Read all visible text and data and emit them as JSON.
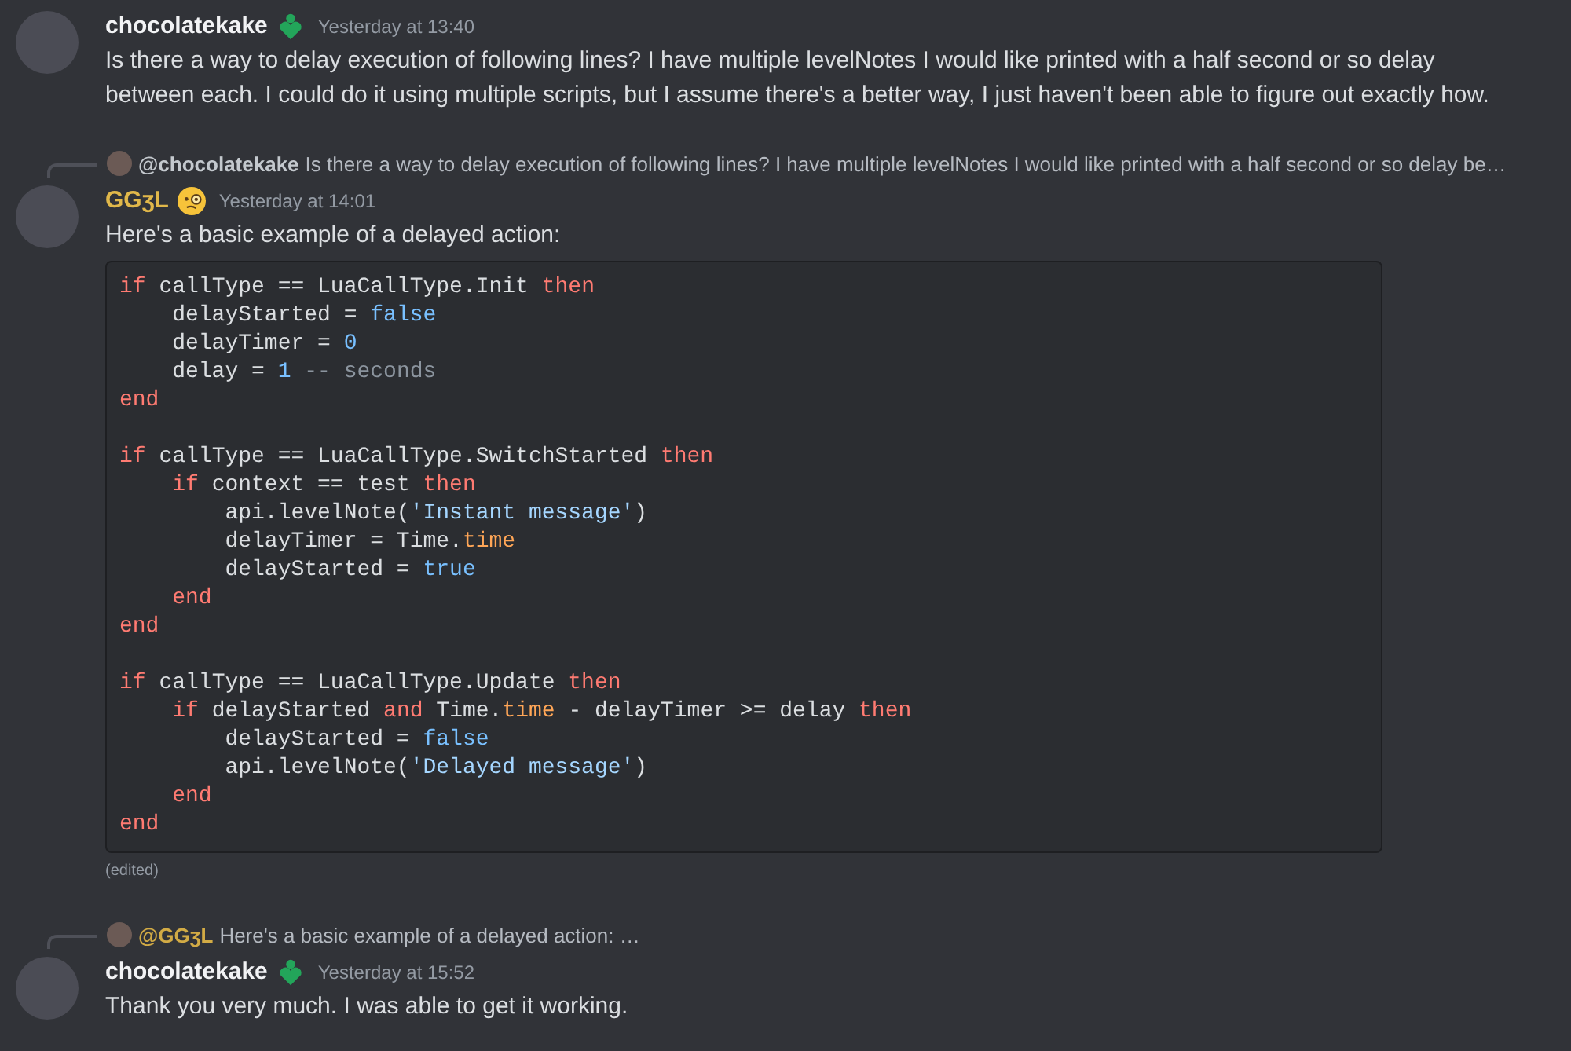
{
  "messages": [
    {
      "author": {
        "name": "chocolatekake",
        "color": "#f2f3f5",
        "badge": {
          "kind": "heart"
        }
      },
      "timestamp": "Yesterday at 13:40",
      "text": "Is there a way to delay execution of following lines? I have multiple levelNotes I would like printed with a half second or so delay between each. I could do it using multiple scripts, but I assume there's a better way, I just haven't been able to figure out exactly how."
    },
    {
      "reply": {
        "mention": "@chocolatekake",
        "color": "#c4c9ce",
        "text": "Is there a way to delay execution of following lines? I have multiple levelNotes I would like printed with a half second or so delay be…"
      },
      "author": {
        "name": "GGʒL",
        "color": "#e1b84a",
        "badge": {
          "kind": "emoji"
        }
      },
      "timestamp": "Yesterday at 14:01",
      "text": "Here's a basic example of a delayed action:",
      "code": {
        "lines": [
          {
            "kind": "code",
            "tokens": [
              {
                "kind": "keyword",
                "text": "if"
              },
              {
                "kind": "plain",
                "text": " callType == LuaCallType.Init "
              },
              {
                "kind": "keyword",
                "text": "then"
              }
            ]
          },
          {
            "kind": "code",
            "tokens": [
              {
                "kind": "plain",
                "text": "    delayStarted = "
              },
              {
                "kind": "literal",
                "text": "false"
              }
            ]
          },
          {
            "kind": "code",
            "tokens": [
              {
                "kind": "plain",
                "text": "    delayTimer = "
              },
              {
                "kind": "literal",
                "text": "0"
              }
            ]
          },
          {
            "kind": "code",
            "tokens": [
              {
                "kind": "plain",
                "text": "    delay = "
              },
              {
                "kind": "literal",
                "text": "1"
              },
              {
                "kind": "comment",
                "text": " -- seconds"
              }
            ]
          },
          {
            "kind": "code",
            "tokens": [
              {
                "kind": "keyword",
                "text": "end"
              }
            ]
          },
          {
            "kind": "blank"
          },
          {
            "kind": "code",
            "tokens": [
              {
                "kind": "keyword",
                "text": "if"
              },
              {
                "kind": "plain",
                "text": " callType == LuaCallType.SwitchStarted "
              },
              {
                "kind": "keyword",
                "text": "then"
              }
            ]
          },
          {
            "kind": "code",
            "tokens": [
              {
                "kind": "keyword",
                "text": "    if"
              },
              {
                "kind": "plain",
                "text": " context == test "
              },
              {
                "kind": "keyword",
                "text": "then"
              }
            ]
          },
          {
            "kind": "code",
            "tokens": [
              {
                "kind": "plain",
                "text": "        api.levelNote("
              },
              {
                "kind": "string",
                "text": "'Instant message'"
              },
              {
                "kind": "plain",
                "text": ")"
              }
            ]
          },
          {
            "kind": "code",
            "tokens": [
              {
                "kind": "plain",
                "text": "        delayTimer = Time."
              },
              {
                "kind": "property",
                "text": "time"
              }
            ]
          },
          {
            "kind": "code",
            "tokens": [
              {
                "kind": "plain",
                "text": "        delayStarted = "
              },
              {
                "kind": "literal",
                "text": "true"
              }
            ]
          },
          {
            "kind": "code",
            "tokens": [
              {
                "kind": "keyword",
                "text": "    end"
              }
            ]
          },
          {
            "kind": "code",
            "tokens": [
              {
                "kind": "keyword",
                "text": "end"
              }
            ]
          },
          {
            "kind": "blank"
          },
          {
            "kind": "code",
            "tokens": [
              {
                "kind": "keyword",
                "text": "if"
              },
              {
                "kind": "plain",
                "text": " callType == LuaCallType.Update "
              },
              {
                "kind": "keyword",
                "text": "then"
              }
            ]
          },
          {
            "kind": "code",
            "tokens": [
              {
                "kind": "keyword",
                "text": "    if"
              },
              {
                "kind": "plain",
                "text": " delayStarted "
              },
              {
                "kind": "keyword",
                "text": "and"
              },
              {
                "kind": "plain",
                "text": " Time."
              },
              {
                "kind": "property",
                "text": "time"
              },
              {
                "kind": "plain",
                "text": " - delayTimer >= delay "
              },
              {
                "kind": "keyword",
                "text": "then"
              }
            ]
          },
          {
            "kind": "code",
            "tokens": [
              {
                "kind": "plain",
                "text": "        delayStarted = "
              },
              {
                "kind": "literal",
                "text": "false"
              }
            ]
          },
          {
            "kind": "code",
            "tokens": [
              {
                "kind": "plain",
                "text": "        api.levelNote("
              },
              {
                "kind": "string",
                "text": "'Delayed message'"
              },
              {
                "kind": "plain",
                "text": ")"
              }
            ]
          },
          {
            "kind": "code",
            "tokens": [
              {
                "kind": "keyword",
                "text": "    end"
              }
            ]
          },
          {
            "kind": "code",
            "tokens": [
              {
                "kind": "keyword",
                "text": "end"
              }
            ]
          }
        ]
      },
      "edited_label": "(edited)"
    },
    {
      "reply": {
        "mention": "@GGʒL",
        "color": "#d2ab45",
        "text": "Here's a basic example of a delayed action: …"
      },
      "author": {
        "name": "chocolatekake",
        "color": "#f2f3f5",
        "badge": {
          "kind": "heart"
        }
      },
      "timestamp": "Yesterday at 15:52",
      "text": "Thank you very much. I was able to get it working."
    }
  ]
}
